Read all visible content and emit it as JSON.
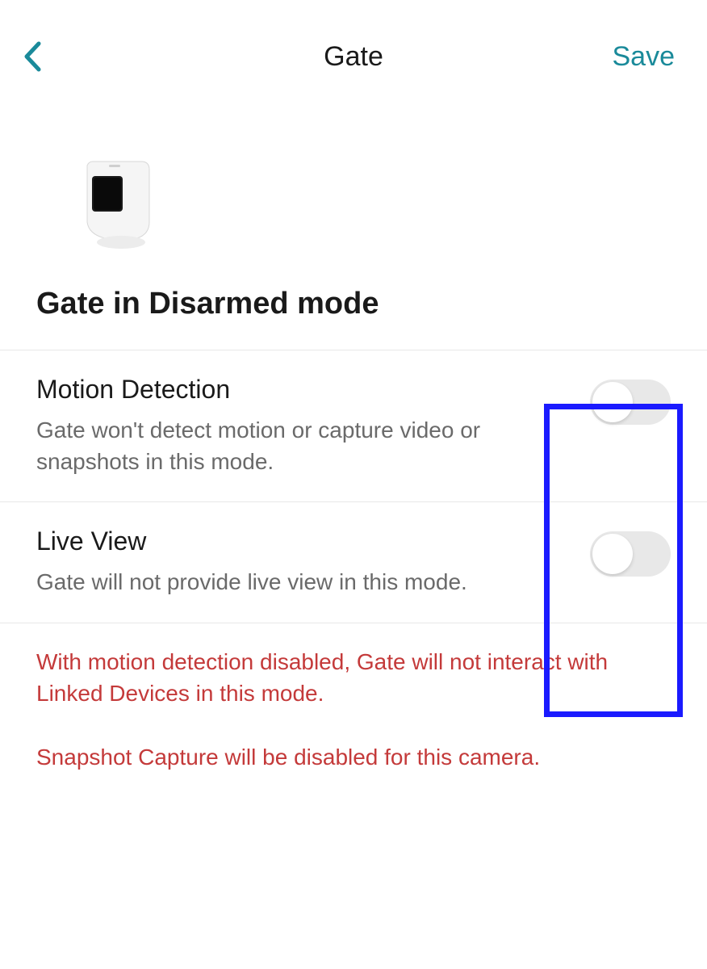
{
  "header": {
    "title": "Gate",
    "save_label": "Save"
  },
  "mode_title": "Gate in Disarmed mode",
  "settings": {
    "motion": {
      "title": "Motion Detection",
      "desc": "Gate won't detect motion or capture video or snapshots in this mode."
    },
    "live": {
      "title": "Live View",
      "desc": "Gate will not provide live view in this mode."
    }
  },
  "warnings": {
    "linked": "With motion detection disabled, Gate will not interact with Linked Devices in this mode.",
    "snapshot": "Snapshot Capture will be disabled for this camera."
  }
}
